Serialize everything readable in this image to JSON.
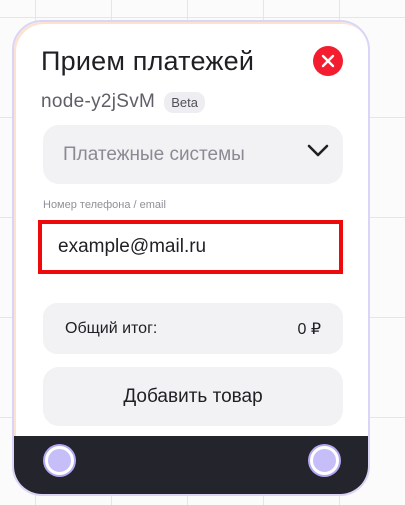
{
  "node": {
    "title": "Прием платежей",
    "id": "node-y2jSvM",
    "badge": "Beta"
  },
  "payment_select": {
    "placeholder": "Платежные системы",
    "icon": "chevron-down-icon"
  },
  "contact_field": {
    "label": "Номер телефона / email",
    "value": "example@mail.ru"
  },
  "total": {
    "label": "Общий итог:",
    "value": "0 ₽"
  },
  "add_item_button": {
    "label": "Добавить товар"
  },
  "colors": {
    "close": "#f31d2f",
    "highlight": "#ee0a0a",
    "footer": "#24242c",
    "port": "#c6bef8"
  }
}
